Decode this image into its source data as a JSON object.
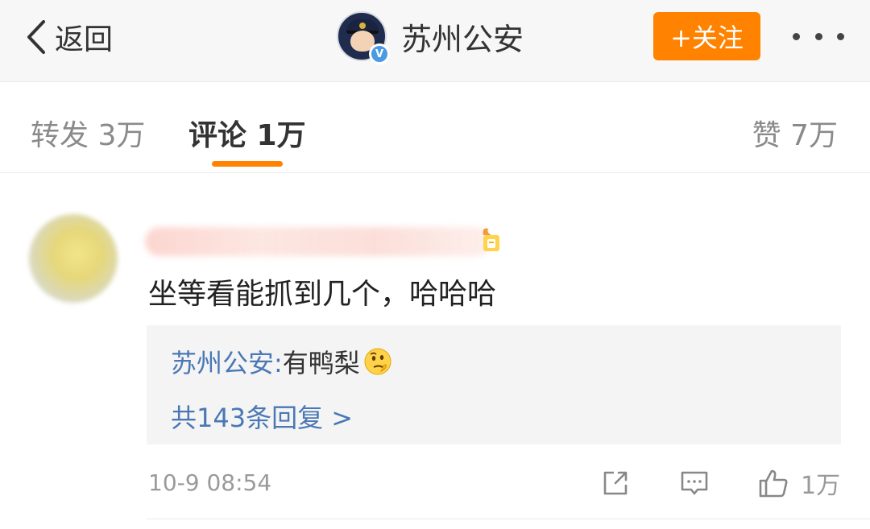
{
  "topbar": {
    "back_label": "返回",
    "account_name": "苏州公安",
    "verified_mark": "V",
    "follow_label": "+关注"
  },
  "tabs": {
    "forward_label": "转发 3万",
    "comment_label": "评论 1万",
    "like_label": "赞 7万",
    "accent_color": "#ff8200"
  },
  "comment": {
    "text": "坐等看能抓到几个，哈哈哈",
    "reply": {
      "author": "苏州公安:",
      "text": " 有鸭梨",
      "emoji": "thinking-emoji",
      "more_label": "共143条回复 >"
    },
    "time": "10-9 08:54",
    "like_count": "1万"
  },
  "colors": {
    "link": "#4a78b5",
    "follow": "#ff8200",
    "muted": "#9a9a9a"
  }
}
